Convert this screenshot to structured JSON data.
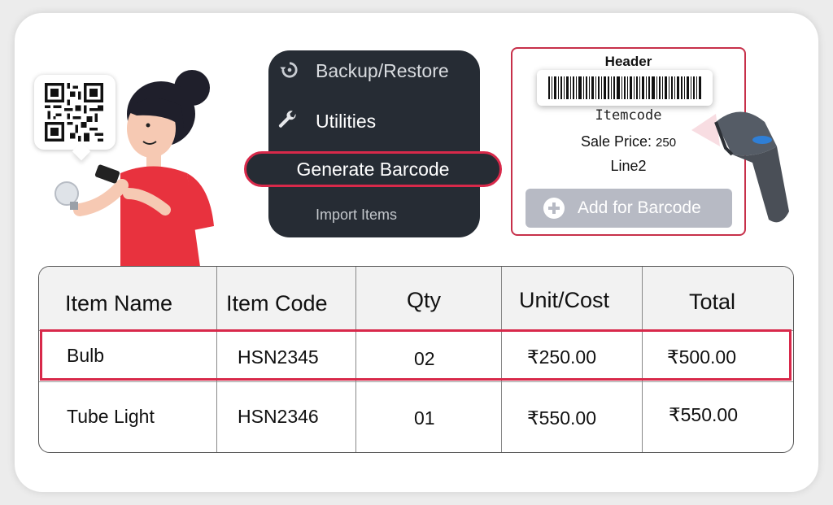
{
  "menu": {
    "backup_label": "Backup/Restore",
    "utilities_label": "Utilities",
    "generate_label": "Generate Barcode",
    "import_label": "Import Items"
  },
  "label_preview": {
    "header": "Header",
    "itemcode": "Itemcode",
    "sale_price_label": "Sale Price:",
    "sale_price_value": "250",
    "line2": "Line2",
    "add_button": "Add for Barcode"
  },
  "table": {
    "headers": [
      "Item Name",
      "Item Code",
      "Qty",
      "Unit/Cost",
      "Total"
    ],
    "rows": [
      [
        "Bulb",
        "HSN2345",
        "02",
        "₹250.00",
        "₹500.00"
      ],
      [
        "Tube Light",
        "HSN2346",
        "01",
        "₹550.00",
        "₹550.00"
      ]
    ],
    "highlighted_row": 0
  },
  "colors": {
    "accent": "#d8294a",
    "menu_bg": "#262c34",
    "disabled_button": "#b7bac4",
    "shirt": "#e8323e"
  },
  "icons": [
    "qr-code-icon",
    "backup-restore-icon",
    "wrench-icon",
    "plus-circle-icon",
    "barcode-icon",
    "barcode-scanner-icon"
  ]
}
